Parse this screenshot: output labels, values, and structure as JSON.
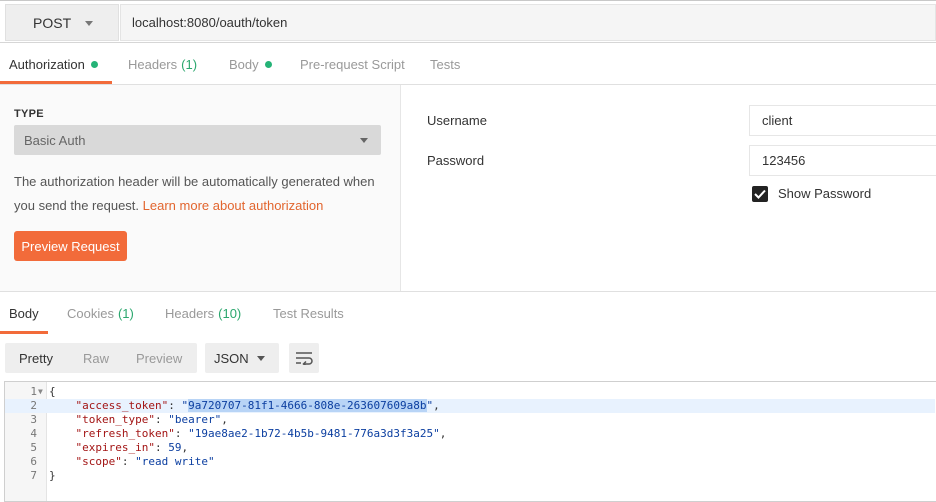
{
  "request": {
    "method": "POST",
    "url": "localhost:8080/oauth/token"
  },
  "request_tabs": [
    {
      "label": "Authorization",
      "dot": true
    },
    {
      "label": "Headers",
      "count": "(1)"
    },
    {
      "label": "Body",
      "dot": true
    },
    {
      "label": "Pre-request Script"
    },
    {
      "label": "Tests"
    }
  ],
  "auth": {
    "type_label": "TYPE",
    "type_value": "Basic Auth",
    "desc_text": "The authorization header will be automatically generated when you send the request. ",
    "desc_link": "Learn more about authorization",
    "preview_button": "Preview Request",
    "username_label": "Username",
    "username_value": "client",
    "password_label": "Password",
    "password_value": "123456",
    "show_password_label": "Show Password",
    "show_password_checked": true
  },
  "response_tabs": [
    {
      "label": "Body"
    },
    {
      "label": "Cookies",
      "count": "(1)"
    },
    {
      "label": "Headers",
      "count": "(10)"
    },
    {
      "label": "Test Results"
    }
  ],
  "response_toolbar": {
    "views": [
      "Pretty",
      "Raw",
      "Preview"
    ],
    "active_view": "Pretty",
    "format": "JSON"
  },
  "response_body": {
    "line_numbers": [
      "1",
      "2",
      "3",
      "4",
      "5",
      "6",
      "7"
    ],
    "access_token_key": "\"access_token\"",
    "access_token_value": "9a720707-81f1-4666-808e-263607609a8b",
    "token_type_key": "\"token_type\"",
    "token_type_value": "\"bearer\"",
    "refresh_token_key": "\"refresh_token\"",
    "refresh_token_value": "\"19ae8ae2-1b72-4b5b-9481-776a3d3f3a25\"",
    "expires_in_key": "\"expires_in\"",
    "expires_in_value": "59",
    "scope_key": "\"scope\"",
    "scope_value": "\"read write\""
  },
  "colors": {
    "accent": "#f26b3a",
    "status_green": "#25b377"
  }
}
